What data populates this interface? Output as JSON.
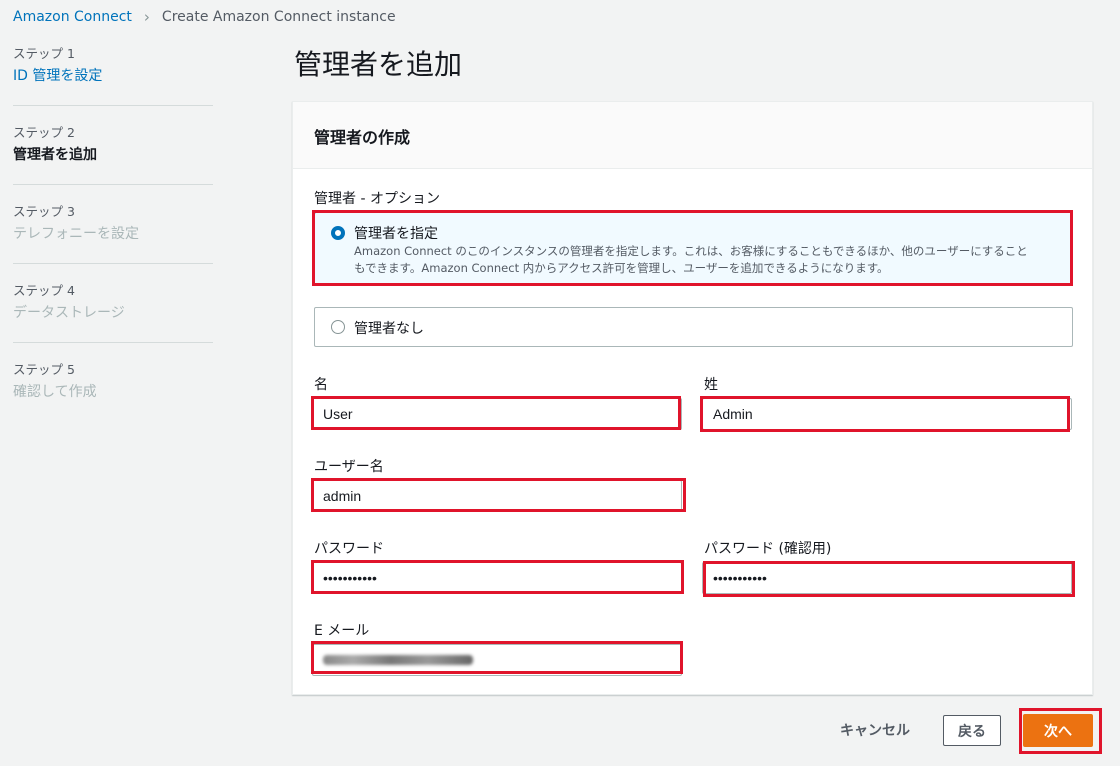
{
  "breadcrumb": {
    "root": "Amazon Connect",
    "current": "Create Amazon Connect instance"
  },
  "steps": [
    {
      "num": "ステップ 1",
      "label": "ID 管理を設定",
      "state": "link"
    },
    {
      "num": "ステップ 2",
      "label": "管理者を追加",
      "state": "current"
    },
    {
      "num": "ステップ 3",
      "label": "テレフォニーを設定",
      "state": "disabled"
    },
    {
      "num": "ステップ 4",
      "label": "データストレージ",
      "state": "disabled"
    },
    {
      "num": "ステップ 5",
      "label": "確認して作成",
      "state": "disabled"
    }
  ],
  "page_title": "管理者を追加",
  "panel": {
    "header": "管理者の作成",
    "admin_option_label": "管理者 - オプション",
    "option_specify": {
      "title": "管理者を指定",
      "desc_line1": "Amazon Connect のこのインスタンスの管理者を指定します。これは、お客様にすることもできるほか、他のユーザーにすること",
      "desc_line2": "もできます。Amazon Connect 内からアクセス許可を管理し、ユーザーを追加できるようになります。",
      "selected": true
    },
    "option_none": {
      "title": "管理者なし",
      "selected": false
    },
    "first_name": {
      "label": "名",
      "value": "User"
    },
    "last_name": {
      "label": "姓",
      "value": "Admin"
    },
    "username": {
      "label": "ユーザー名",
      "value": "admin"
    },
    "password": {
      "label": "パスワード",
      "value": "•••••••••••"
    },
    "password_confirm": {
      "label": "パスワード (確認用)",
      "value": "•••••••••••"
    },
    "email": {
      "label": "E メール"
    }
  },
  "footer": {
    "cancel": "キャンセル",
    "back": "戻る",
    "next": "次へ"
  },
  "colors": {
    "highlight": "#e0142b",
    "primary": "#ec7211",
    "link": "#0073bb"
  }
}
